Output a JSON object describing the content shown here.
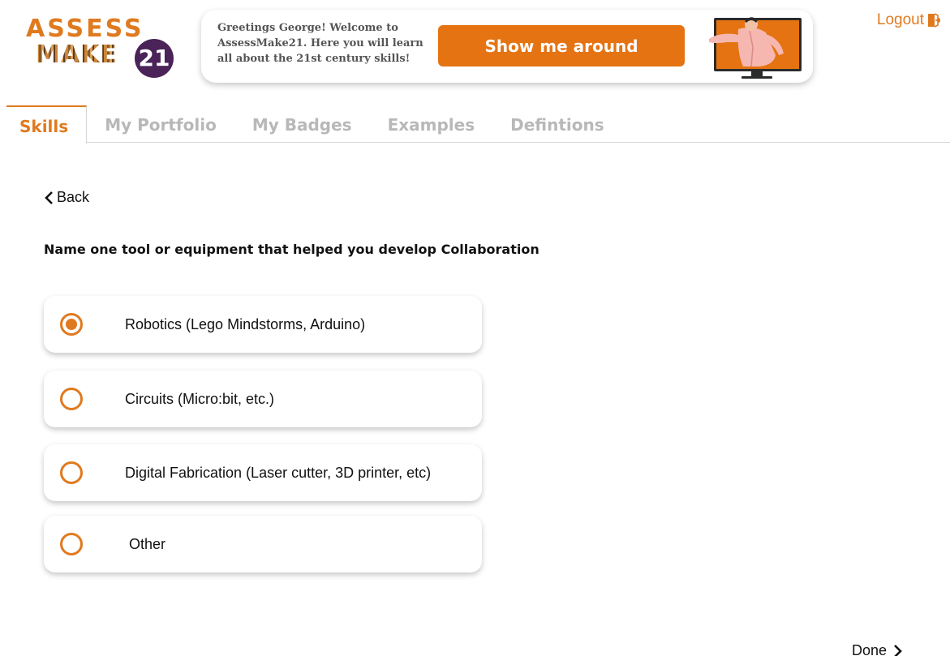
{
  "logo": {
    "line1": "ASSESS",
    "line2": "MAKE",
    "badge": "21",
    "colors": {
      "orange": "#e07a1f",
      "purple": "#4a2358"
    }
  },
  "welcome": {
    "message": "Greetings George! Welcome to AssessMake21. Here you will learn all about the 21st century skills!",
    "tour_button": "Show me around",
    "illustration_icon": "presenter-monitor-icon"
  },
  "header": {
    "logout_label": "Logout",
    "logout_icon": "logout-door-icon"
  },
  "tabs": [
    {
      "label": "Skills",
      "active": true
    },
    {
      "label": "My Portfolio",
      "active": false
    },
    {
      "label": "My Badges",
      "active": false
    },
    {
      "label": "Examples",
      "active": false
    },
    {
      "label": "Defintions",
      "active": false
    }
  ],
  "nav": {
    "back_label": "Back",
    "done_label": "Done"
  },
  "question": {
    "text": "Name one tool or equipment that helped you develop Collaboration",
    "options": [
      {
        "label": "Robotics (Lego Mindstorms, Arduino)",
        "selected": true
      },
      {
        "label": "Circuits (Micro:bit, etc.)",
        "selected": false
      },
      {
        "label": "Digital Fabrication (Laser cutter, 3D printer, etc)",
        "selected": false
      },
      {
        "label": " Other",
        "selected": false
      }
    ]
  },
  "colors": {
    "accent": "#e07a1f",
    "button": "#e57312",
    "tab_inactive": "#b8b8b8"
  }
}
